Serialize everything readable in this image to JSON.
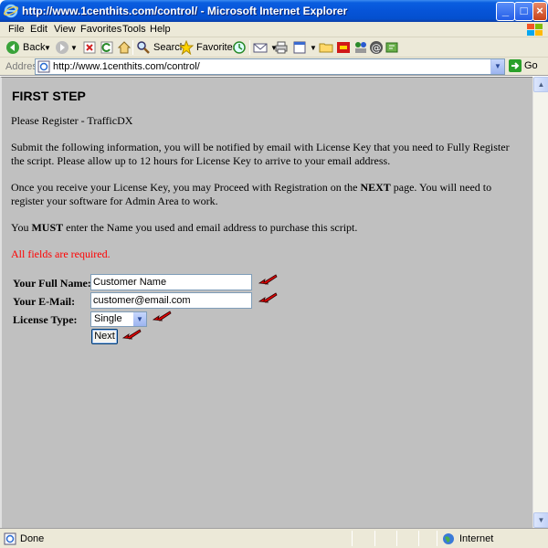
{
  "window": {
    "title": "http://www.1centhits.com/control/ - Microsoft Internet Explorer",
    "min_glyph": "_",
    "max_glyph": "□",
    "close_glyph": "×"
  },
  "menu": {
    "items": [
      "File",
      "Edit",
      "View",
      "Favorites",
      "Tools",
      "Help"
    ]
  },
  "toolbar": {
    "back_label": "Back",
    "search_label": "Search",
    "favorites_label": "Favorites"
  },
  "address": {
    "label": "Address",
    "url": "http://www.1centhits.com/control/",
    "go_label": "Go"
  },
  "page": {
    "heading": "FIRST STEP",
    "intro": "Please Register - TrafficDX",
    "para1": "Submit the following information, you will be notified by email with License Key that you need to Fully Register the script. Please allow up to 12 hours for License Key to arrive to your email address.",
    "para2_pre": "Once you receive your License Key, you may Proceed with Registration on the ",
    "para2_bold": "NEXT",
    "para2_post": " page. You will need to register your software for Admin Area to work.",
    "para3_pre": "You ",
    "para3_bold": "MUST",
    "para3_post": " enter the Name you used and email address to purchase this script.",
    "required": "All fields are required.",
    "form": {
      "name_label": "Your Full Name:",
      "name_value": "Customer Name",
      "email_label": "Your E-Mail:",
      "email_value": "customer@email.com",
      "license_label": "License Type:",
      "license_value": "Single",
      "next_label": "Next"
    }
  },
  "status": {
    "text": "Done",
    "zone": "Internet"
  },
  "colors": {
    "content_bg": "#c0c0c0",
    "required_text": "#ff0000",
    "titlebar": "#0654d8",
    "arrow": "#e00000"
  }
}
